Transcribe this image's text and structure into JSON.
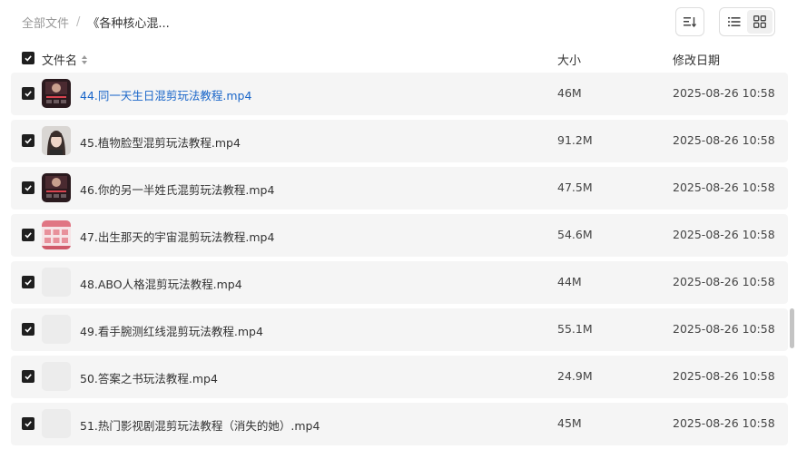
{
  "breadcrumb": {
    "root": "全部文件",
    "separator": "/",
    "current": "《各种核心混..."
  },
  "toolbar": {
    "sort_icon": "sort-list-icon",
    "view_list_icon": "list-view-icon",
    "view_grid_icon": "grid-view-icon",
    "active_view": "list"
  },
  "header": {
    "name": "文件名",
    "size": "大小",
    "modified": "修改日期"
  },
  "files": [
    {
      "name": "44.同一天生日混剪玩法教程.mp4",
      "size": "46M",
      "date": "2025-08-26 10:58",
      "thumb": "video-dark",
      "highlighted": true
    },
    {
      "name": "45.植物脸型混剪玩法教程.mp4",
      "size": "91.2M",
      "date": "2025-08-26 10:58",
      "thumb": "portrait"
    },
    {
      "name": "46.你的另一半姓氏混剪玩法教程.mp4",
      "size": "47.5M",
      "date": "2025-08-26 10:58",
      "thumb": "video-dark"
    },
    {
      "name": "47.出生那天的宇宙混剪玩法教程.mp4",
      "size": "54.6M",
      "date": "2025-08-26 10:58",
      "thumb": "pink-grid"
    },
    {
      "name": "48.ABO人格混剪玩法教程.mp4",
      "size": "44M",
      "date": "2025-08-26 10:58",
      "thumb": "empty"
    },
    {
      "name": "49.看手腕测红线混剪玩法教程.mp4",
      "size": "55.1M",
      "date": "2025-08-26 10:58",
      "thumb": "empty"
    },
    {
      "name": "50.答案之书玩法教程.mp4",
      "size": "24.9M",
      "date": "2025-08-26 10:58",
      "thumb": "empty"
    },
    {
      "name": "51.热门影视剧混剪玩法教程（消失的她）.mp4",
      "size": "45M",
      "date": "2025-08-26 10:58",
      "thumb": "empty"
    }
  ],
  "colors": {
    "link": "#1a66c9",
    "row_bg": "#f5f5f5",
    "checkbox": "#1f1f1f"
  }
}
